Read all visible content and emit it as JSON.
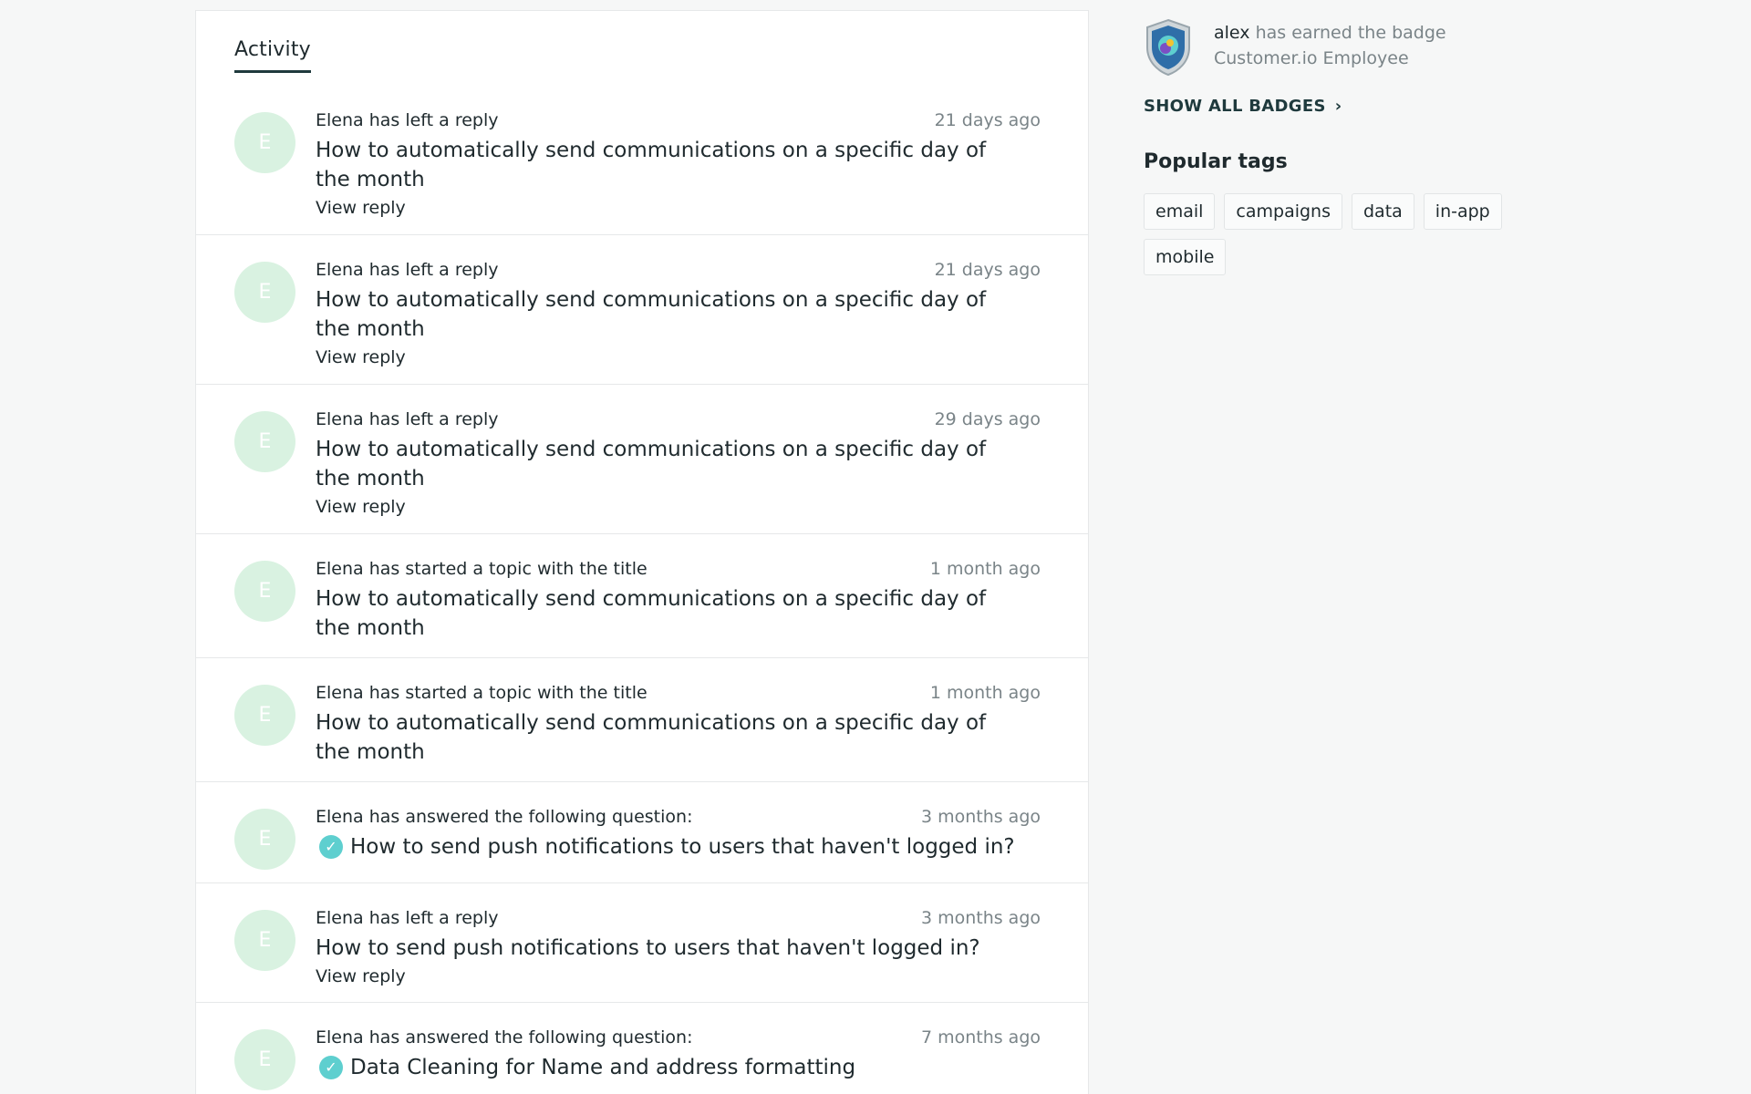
{
  "activity": {
    "tab_label": "Activity",
    "items": [
      {
        "action": "Elena has left a reply",
        "time": "21 days ago",
        "title": "How to automatically send communications on a specific day of the month",
        "view_label": "View reply",
        "avatar_letter": "E"
      },
      {
        "action": "Elena has left a reply",
        "time": "21 days ago",
        "title": "How to automatically send communications on a specific day of the month",
        "view_label": "View reply",
        "avatar_letter": "E"
      },
      {
        "action": "Elena has left a reply",
        "time": "29 days ago",
        "title": "How to automatically send communications on a specific day of the month",
        "view_label": "View reply",
        "avatar_letter": "E"
      },
      {
        "action": "Elena has started a topic with the title",
        "time": "1 month ago",
        "title": "How to automatically send communications on a specific day of the month",
        "avatar_letter": "E"
      },
      {
        "action": "Elena has started a topic with the title",
        "time": "1 month ago",
        "title": "How to automatically send communications on a specific day of the month",
        "avatar_letter": "E"
      },
      {
        "action": "Elena has answered the following question:",
        "time": "3 months ago",
        "title": "How to send push notifications to users that haven't logged in?",
        "avatar_letter": "E",
        "solved_icon": "checkmark-circle-icon"
      },
      {
        "action": "Elena has left a reply",
        "time": "3 months ago",
        "title": "How to send push notifications to users that haven't logged in?",
        "view_label": "View reply",
        "avatar_letter": "E"
      },
      {
        "action": "Elena has answered the following question:",
        "time": "7 months ago",
        "title": "Data Cleaning for Name and address formatting",
        "avatar_letter": "E",
        "solved_icon": "checkmark-circle-icon"
      }
    ]
  },
  "sidebar": {
    "badge": {
      "user": "alex",
      "text": "has earned the badge",
      "badge_name": "Customer.io Employee",
      "icon": "shield-badge-icon"
    },
    "show_all_badges_label": "SHOW ALL BADGES",
    "popular_tags_title": "Popular tags",
    "tags": [
      "email",
      "campaigns",
      "data",
      "in-app",
      "mobile"
    ]
  },
  "colors": {
    "background": "#f6f7f7",
    "avatar_bg": "#d9f2e1",
    "solved_check": "#5ecfcf",
    "text_dark": "#1f2a2e",
    "text_muted": "#7a8488"
  }
}
